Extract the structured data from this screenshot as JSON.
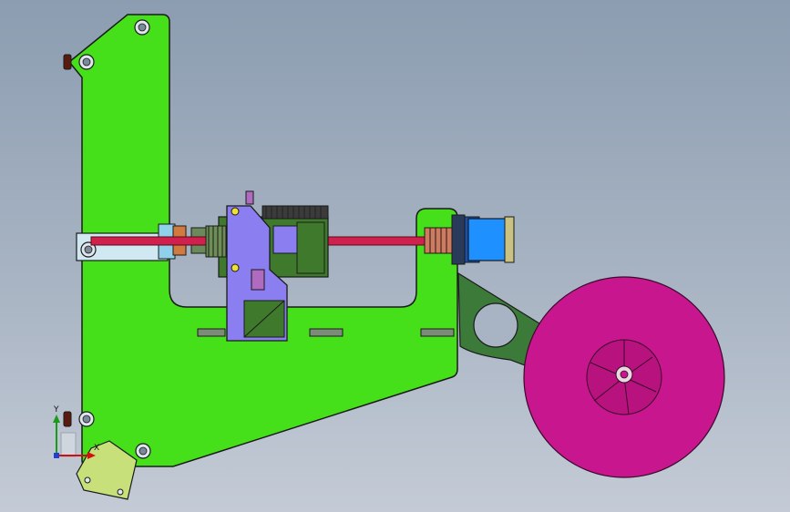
{
  "viewport": {
    "background_top": "#8c9db1",
    "background_bottom": "#c4cbd6"
  },
  "colors": {
    "frame": "#46e01a",
    "rod": "#d0214e",
    "carriage": "#8a7ef0",
    "motor_dark": "#3f7a2c",
    "motor_blue": "#1e90ff",
    "motor_tan": "#c9c280",
    "arm": "#3c7a3a",
    "spool": "#c8168f",
    "bracket": "#c8e07a",
    "edge": "#1a1a1a"
  },
  "triad": {
    "y_label": "Y",
    "x_label": "X"
  }
}
